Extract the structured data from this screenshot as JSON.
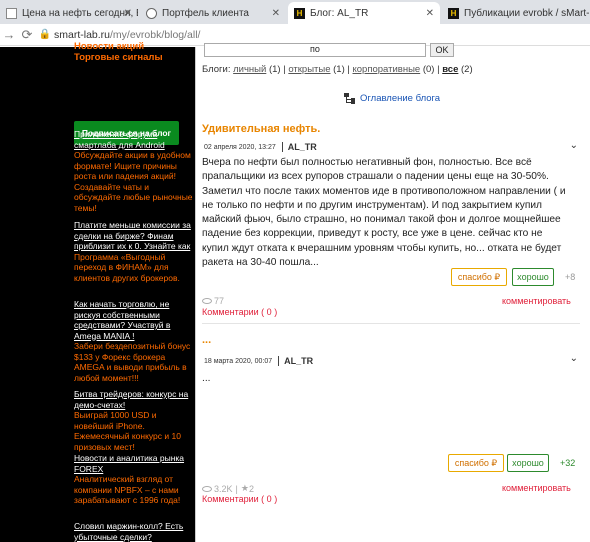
{
  "browser": {
    "tabs": [
      {
        "title": "Цена на нефть сегодня, Brent",
        "favicon": "doc-icon"
      },
      {
        "title": "Портфель клиента",
        "favicon": "globe-icon"
      },
      {
        "title": "Блог: AL_TR",
        "favicon": "smartlab-icon"
      },
      {
        "title": "Публикации evrobk / sMart-lab",
        "favicon": "smartlab-icon"
      }
    ],
    "close_glyph": "✕",
    "url_host": "smart-lab.ru",
    "url_path": "/my/evrobk/blog/all/"
  },
  "sidebar": {
    "top_link_cut": "Новости акций",
    "top_link": "Торговые сигналы",
    "subscribe_label": "Подписаться на блог",
    "promos": [
      {
        "title": "Приложение форума смартлаба для Android",
        "body": "Обсуждайте акции в удобном формате! Ищите причины роста или падения акций! Создавайте чаты и обсуждайте любые рыночные темы!"
      },
      {
        "title": "Платите меньше комиссии за сделки на бирже? Финам приблизит их к 0. Узнайте как",
        "body": "Программа «Выгодный переход в ФИНАМ» для клиентов других брокеров."
      },
      {
        "title": "Как начать торговлю, не рискуя собственными средствами? Участвуй в Amega MANIA !",
        "body": "Забери бездепозитный бонус $133 у Форекс брокера AMEGA и выводи прибыль в любой момент!!!"
      },
      {
        "title": "Битва трейдеров: конкурс на демо-счетах!",
        "body": "Выиграй 1000 USD и новейший iPhone. Ежемесячный конкурс и 10 призовых мест!"
      },
      {
        "title": "Новости и аналитика рынка FOREX",
        "body": "Аналитический взгляд от компании NPBFX – с нами зарабатывают с 1996 года!"
      },
      {
        "title": "Словил маржин-колл? Есть убыточные сделки?",
        "body": ""
      }
    ]
  },
  "search": {
    "value": "по",
    "ok_label": "OK"
  },
  "blog_filter": {
    "prefix": "Блоги:",
    "items": [
      {
        "label": "личный",
        "count": "(1)"
      },
      {
        "label": "открытые",
        "count": "(1)"
      },
      {
        "label": "корпоративные",
        "count": "(0)"
      },
      {
        "label": "все",
        "count": "(2)"
      }
    ],
    "sep": "|"
  },
  "toc_label": "Оглавление блога",
  "posts": [
    {
      "title": "Удивительная нефть.",
      "date": "02 апреля 2020, 13:27",
      "author": "AL_TR",
      "body": "Вчера по нефти был полностью негативный фон, полностью. Все всё прапальщики из всех рупоров страшали о падении цены еще на 30-50%. Заметил что после таких моментов иде в противоположном направлении ( и не только по нефти и по другим инструментам). И под закрытием купил майский фьюч, было страшно, но понимал такой фон и долгое мощнейшее падение без коррекции, приведут к росту, все уже в цене. сейчас кто не купил ждут отката к вчерашним уровням чтобы купить, но... откатa не будет ракета на 30-40 пошла...",
      "spasibo": "спасибо ₽",
      "horosho": "хорошо",
      "score": "+8",
      "views": "77",
      "comments": "Комментарии ( 0 )",
      "comment_link": "комментировать"
    },
    {
      "title": "...",
      "date": "18 марта 2020, 00:07",
      "author": "AL_TR",
      "body": "...",
      "spasibo": "спасибо ₽",
      "horosho": "хорошо",
      "score": "+32",
      "views": "3.2K",
      "reposts": "2",
      "comments": "Комментарии ( 0 )",
      "comment_link": "комментировать"
    }
  ]
}
